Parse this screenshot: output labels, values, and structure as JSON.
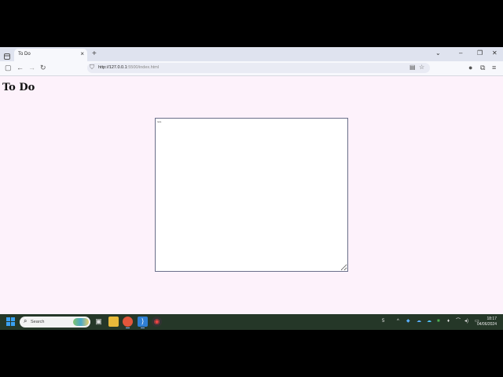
{
  "browser": {
    "tab_title": "To Do",
    "tab_close": "×",
    "new_tab": "+",
    "url_host": "http://127.0.0.1",
    "url_rest": ":5500/index.html",
    "win_minimize": "–",
    "win_restore": "❐",
    "win_close": "✕"
  },
  "page": {
    "title": "To Do",
    "textarea_value": "rere"
  },
  "taskbar": {
    "search_label": "Search",
    "time": "18:17",
    "date": "04/06/2024",
    "tray_badge": "5"
  },
  "colors": {
    "page_bg": "#fdf2fb",
    "taskbar_bg": "#253728",
    "tab_bar_bg": "#dfe3ef"
  }
}
